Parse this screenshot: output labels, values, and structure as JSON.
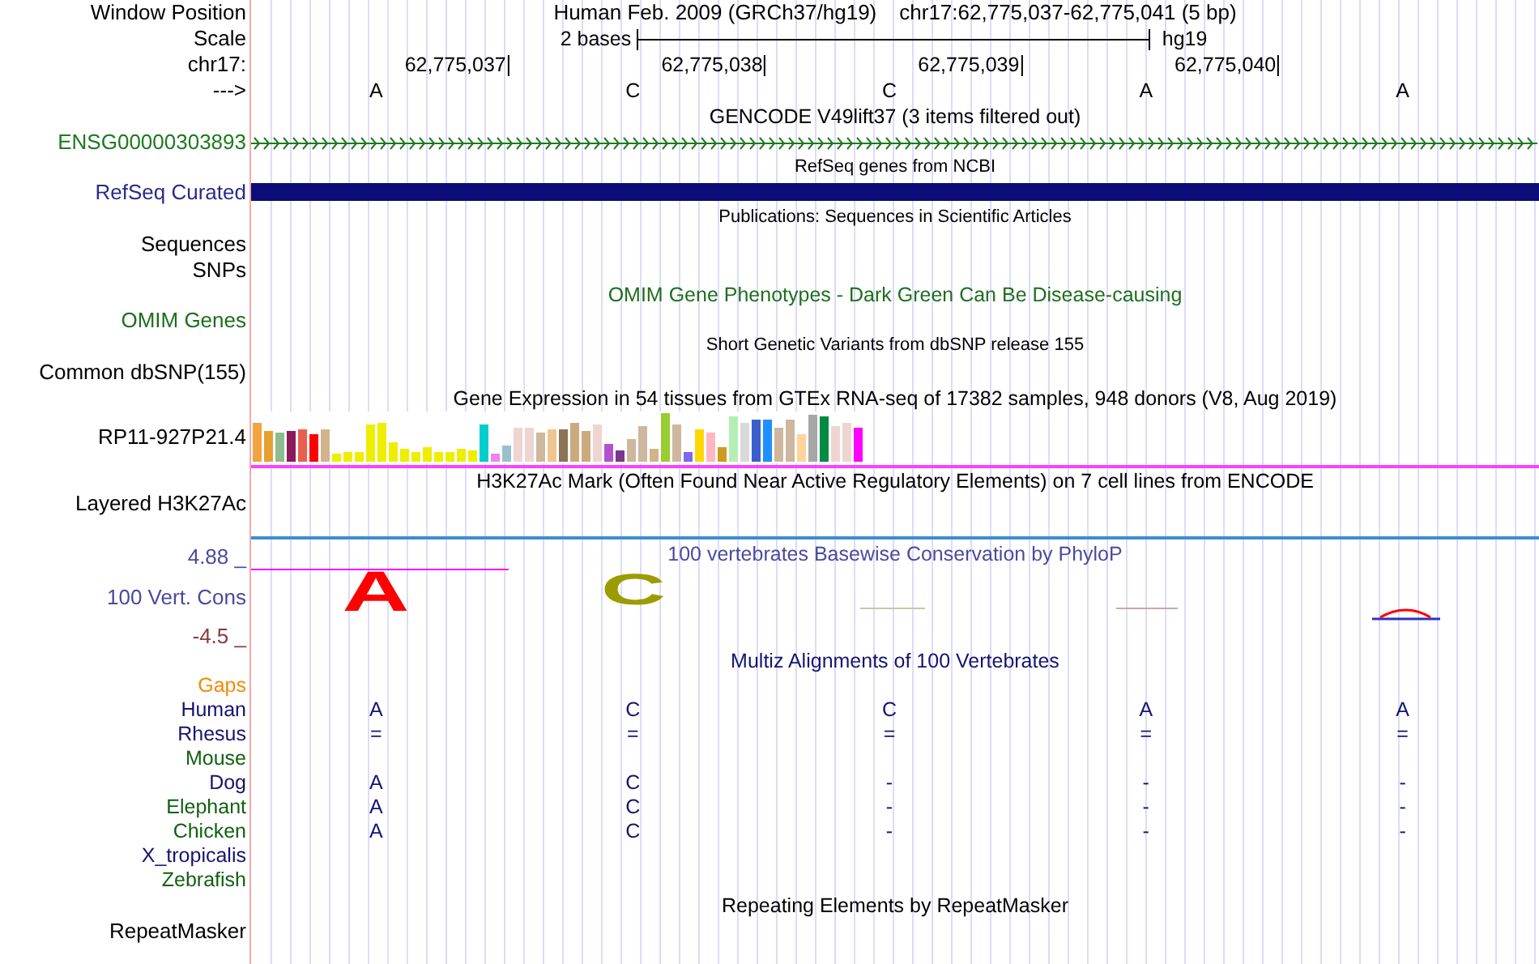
{
  "header": {
    "label": "Window Position",
    "title": "Human Feb. 2009 (GRCh37/hg19)",
    "position": "chr17:62,775,037-62,775,041 (5 bp)"
  },
  "scale": {
    "label": "Scale",
    "span": "2 bases",
    "assembly": "hg19"
  },
  "ruler": {
    "label": "chr17:",
    "ticks": [
      "62,775,037",
      "62,775,038",
      "62,775,039",
      "62,775,040"
    ]
  },
  "bases": {
    "label": "--->",
    "letters": [
      "A",
      "C",
      "C",
      "A",
      "A"
    ]
  },
  "tracks": [
    {
      "kind": "arrows",
      "title": {
        "text": "GENCODE V49lift37 (3 items filtered out)",
        "color": "#000000",
        "small": false
      },
      "label": {
        "text": "ENSG00000303893",
        "color": "#1e7a1e"
      }
    },
    {
      "kind": "bar",
      "title": {
        "text": "RefSeq genes from NCBI",
        "color": "#000000",
        "small": true
      },
      "label": {
        "text": "RefSeq Curated",
        "color": "#2a2a8c"
      }
    },
    {
      "kind": "none",
      "title": {
        "text": "Publications: Sequences in Scientific Articles",
        "color": "#000000",
        "small": true
      },
      "label": {
        "text": "Sequences",
        "color": "#000000"
      }
    },
    {
      "kind": "none",
      "label": {
        "text": "SNPs",
        "color": "#000000"
      }
    },
    {
      "kind": "none",
      "title": {
        "text": "OMIM Gene Phenotypes - Dark Green Can Be Disease-causing",
        "color": "#1e6e1e",
        "small": false
      },
      "label": {
        "text": "OMIM Genes",
        "color": "#1e6e1e"
      }
    },
    {
      "kind": "none",
      "title": {
        "text": "Short Genetic Variants from dbSNP release 155",
        "color": "#000000",
        "small": true
      },
      "label": {
        "text": "Common dbSNP(155)",
        "color": "#000000"
      }
    },
    {
      "kind": "expression",
      "title": {
        "text": "Gene Expression in 54 tissues from GTEx RNA-seq of 17382 samples, 948 donors (V8, Aug 2019)",
        "color": "#000000",
        "small": false
      },
      "label": {
        "text": "RP11-927P21.4",
        "color": "#000000"
      }
    },
    {
      "kind": "line",
      "title": {
        "text": "H3K27Ac Mark (Often Found Near Active Regulatory Elements) on 7 cell lines from ENCODE",
        "color": "#000000",
        "small": false
      },
      "label": {
        "text": "Layered H3K27Ac",
        "color": "#000000"
      }
    },
    {
      "kind": "conservation",
      "title": {
        "text": "100 vertebrates Basewise Conservation by PhyloP",
        "color": "#4a4a9e",
        "small": false
      },
      "label": {
        "text": "100 Vert. Cons",
        "color": "#4a4a9e"
      },
      "max": {
        "text": "4.88 _",
        "color": "#4a4a9e"
      },
      "min": {
        "text": "-4.5 _",
        "color": "#8b3a3a"
      },
      "logo": [
        {
          "letter": "A",
          "color": "#ff0000"
        },
        {
          "letter": "C",
          "color": "#9c9c00"
        }
      ]
    },
    {
      "kind": "alignment",
      "title": {
        "text": "Multiz Alignments of 100 Vertebrates",
        "color": "#141470",
        "small": false
      },
      "species": [
        {
          "name": "Gaps",
          "color": "#f08c00"
        },
        {
          "name": "Human",
          "color": "#141470",
          "cells": [
            "A",
            "C",
            "C",
            "A",
            "A"
          ]
        },
        {
          "name": "Rhesus",
          "color": "#141470",
          "cells": [
            "=",
            "=",
            "=",
            "=",
            "="
          ]
        },
        {
          "name": "Mouse",
          "color": "#106010"
        },
        {
          "name": "Dog",
          "color": "#141470",
          "cells": [
            "A",
            "C",
            "-",
            "-",
            "-"
          ]
        },
        {
          "name": "Elephant",
          "color": "#106010",
          "cells": [
            "A",
            "C",
            "-",
            "-",
            "-"
          ]
        },
        {
          "name": "Chicken",
          "color": "#106010",
          "cells": [
            "A",
            "C",
            "-",
            "-",
            "-"
          ]
        },
        {
          "name": "X_tropicalis",
          "color": "#141470"
        },
        {
          "name": "Zebrafish",
          "color": "#106010"
        }
      ]
    },
    {
      "kind": "none",
      "title": {
        "text": "Repeating Elements by RepeatMasker",
        "color": "#000000",
        "small": false
      },
      "label": {
        "text": "RepeatMasker",
        "color": "#000000"
      }
    }
  ]
}
